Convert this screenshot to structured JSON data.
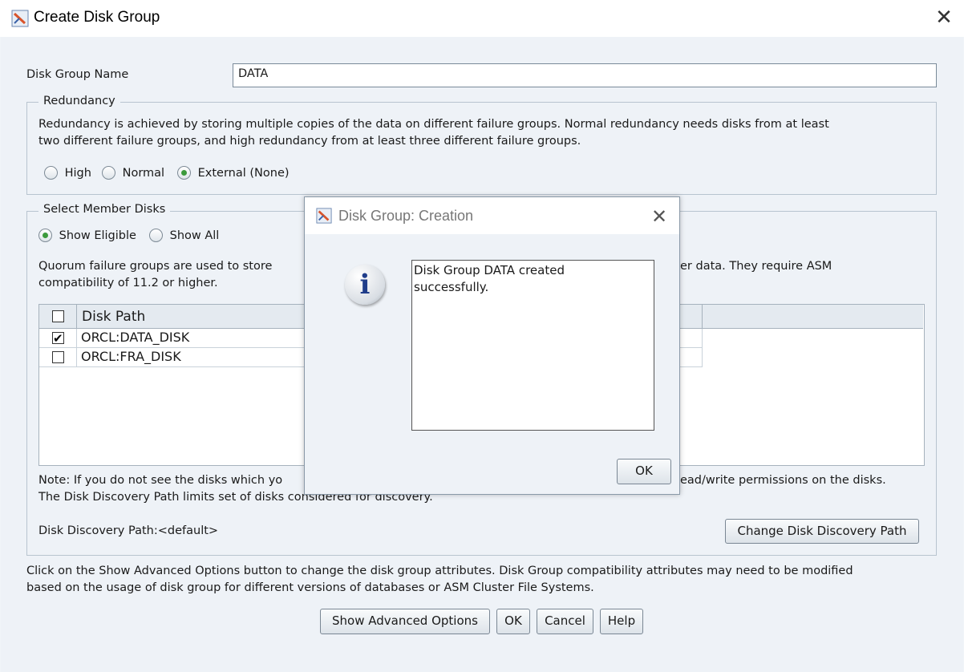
{
  "window": {
    "title": "Create Disk Group",
    "close_glyph": "✕"
  },
  "form": {
    "name_label": "Disk Group Name",
    "name_value": "DATA"
  },
  "redundancy": {
    "legend": "Redundancy",
    "description_line1": "Redundancy is achieved by storing multiple copies of the data on different failure groups. Normal redundancy needs disks from at least",
    "description_line2": "two different failure groups, and high redundancy from at least three different failure groups.",
    "options": [
      {
        "label": "High",
        "selected": false
      },
      {
        "label": "Normal",
        "selected": false
      },
      {
        "label": "External (None)",
        "selected": true
      }
    ]
  },
  "member_disks": {
    "legend": "Select Member Disks",
    "filters": [
      {
        "label": "Show Eligible",
        "selected": true
      },
      {
        "label": "Show All",
        "selected": false
      }
    ],
    "quorum_left_line1": "Quorum failure groups are used to store",
    "quorum_right_line1": "er data. They require ASM",
    "quorum_line2": "compatibility of 11.2 or higher.",
    "table": {
      "header": "Disk Path",
      "rows": [
        {
          "checked": true,
          "path": "ORCL:DATA_DISK"
        },
        {
          "checked": false,
          "path": "ORCL:FRA_DISK"
        }
      ]
    },
    "note_left_line1": "Note: If you do not see the disks which yo",
    "note_right_line1": "ead/write permissions on the disks.",
    "note_line2": "The Disk Discovery Path limits set of disks considered for discovery.",
    "discovery_path_label": "Disk Discovery Path:<default>",
    "change_path_button": "Change Disk Discovery Path"
  },
  "footer": {
    "info_line1": "Click on the Show Advanced Options button to change the disk group attributes. Disk Group compatibility attributes may need to be modified",
    "info_line2": "based on the usage of disk group for different versions of databases or ASM Cluster File Systems.",
    "buttons": {
      "advanced": "Show Advanced Options",
      "ok": "OK",
      "cancel": "Cancel",
      "help": "Help"
    }
  },
  "dialog": {
    "title": "Disk Group: Creation",
    "close_glyph": "✕",
    "icon": "info-icon",
    "icon_glyph": "i",
    "message_line1": "Disk Group DATA created",
    "message_line2": "successfully.",
    "ok_button": "OK"
  },
  "colors": {
    "accent_radio": "#3c9a3c",
    "info_icon_blue": "#1f3d8a"
  }
}
